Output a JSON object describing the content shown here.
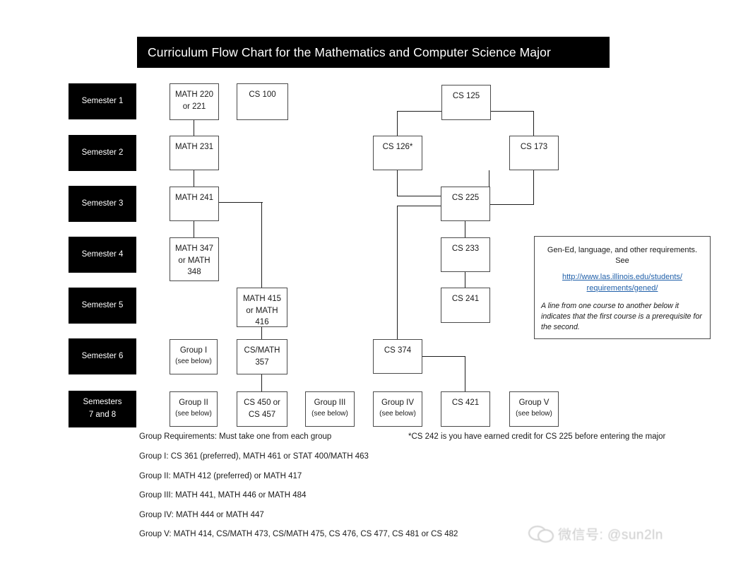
{
  "title": "Curriculum Flow Chart for the Mathematics and Computer Science Major",
  "semesters": [
    {
      "line1": "Semester 1",
      "line2": ""
    },
    {
      "line1": "Semester 2",
      "line2": ""
    },
    {
      "line1": "Semester 3",
      "line2": ""
    },
    {
      "line1": "Semester 4",
      "line2": ""
    },
    {
      "line1": "Semester 5",
      "line2": ""
    },
    {
      "line1": "Semester 6",
      "line2": ""
    },
    {
      "line1": "Semesters",
      "line2": "7 and 8"
    }
  ],
  "courses": {
    "math220": {
      "line1": "MATH 220",
      "line2": "or 221"
    },
    "cs100": {
      "line1": "CS 100",
      "line2": ""
    },
    "cs125": {
      "line1": "CS 125",
      "line2": ""
    },
    "math231": {
      "line1": "MATH 231",
      "line2": ""
    },
    "cs126": {
      "line1": "CS 126*",
      "line2": ""
    },
    "cs173": {
      "line1": "CS 173",
      "line2": ""
    },
    "math241": {
      "line1": "MATH 241",
      "line2": ""
    },
    "cs225": {
      "line1": "CS 225",
      "line2": ""
    },
    "math347": {
      "line1": "MATH 347",
      "line2": "or MATH",
      "line3": "348"
    },
    "cs233": {
      "line1": "CS 233",
      "line2": ""
    },
    "math415": {
      "line1": "MATH 415",
      "line2": "or MATH",
      "line3": "416"
    },
    "cs241": {
      "line1": "CS 241",
      "line2": ""
    },
    "group1": {
      "line1": "Group I",
      "line2": "(see below)"
    },
    "csmath357": {
      "line1": "CS/MATH",
      "line2": "357"
    },
    "cs374": {
      "line1": "CS 374",
      "line2": ""
    },
    "group2": {
      "line1": "Group II",
      "line2": "(see below)"
    },
    "cs450": {
      "line1": "CS 450 or",
      "line2": "CS 457"
    },
    "group3": {
      "line1": "Group III",
      "line2": "(see below)"
    },
    "group4": {
      "line1": "Group IV",
      "line2": "(see below)"
    },
    "cs421": {
      "line1": "CS 421",
      "line2": ""
    },
    "group5": {
      "line1": "Group V",
      "line2": "(see below)"
    }
  },
  "note": {
    "intro": "Gen-Ed, language, and other requirements. See",
    "url_line1": "http://www.las.illinois.edu/students/",
    "url_line2": "requirements/gened/",
    "italic": "A line from one course to another below it indicates that the first course is a prerequisite for the second."
  },
  "footnotes": {
    "group_requirements": "Group Requirements: Must take one from each group",
    "asterisk_note": "*CS 242 is you have earned credit for CS 225 before entering the major",
    "group1": "Group I:  CS 361 (preferred), MATH 461 or STAT 400/MATH 463",
    "group2": "Group II:  MATH 412 (preferred) or MATH 417",
    "group3": "Group III:  MATH 441, MATH 446 or MATH 484",
    "group4": "Group IV:  MATH 444 or MATH 447",
    "group5": "Group V:  MATH 414, CS/MATH 473, CS/MATH 475, CS 476, CS 477, CS 481 or CS 482"
  },
  "watermark": {
    "text": "微信号: @sun2ln"
  },
  "colors": {
    "banner_bg": "#000000",
    "banner_text": "#ffffff",
    "box_border": "#4a4a4a",
    "line": "#1d1d1d",
    "link": "#1f5fa9",
    "page_bg": "#ffffff"
  }
}
